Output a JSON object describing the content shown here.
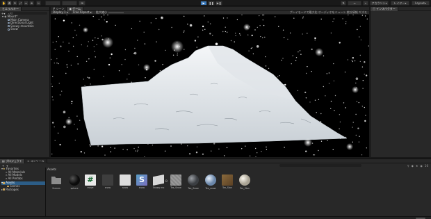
{
  "toolbar": {
    "play": "▶",
    "pause": "❚❚",
    "step": "▶❚",
    "account": "アカウント",
    "layers": "レイヤー",
    "layout": "Layout",
    "cloud": "☁"
  },
  "hierarchy": {
    "tab": "ヒエラルキー",
    "search_placeholder": "All",
    "scene": "Mount*",
    "items": [
      "Main Camera",
      "Directional Light",
      "Snowy mountain",
      "Snow"
    ]
  },
  "scene_view": {
    "tabs": [
      "シーン",
      "ゲーム"
    ],
    "display": "Display 1",
    "aspect": "Free Aspect",
    "scale": "拡大縮小",
    "right_options": "プレイモードで最大化  オーディオをミュート  統計情報  ギズモ"
  },
  "inspector": {
    "tab": "インスペクター"
  },
  "project": {
    "tabs": [
      "プロジェクト",
      "コンソール"
    ],
    "add": "+",
    "favorites": "Favorites",
    "favorite_items": [
      "All Materials",
      "All Models",
      "All Prefabs"
    ],
    "assets": "Assets",
    "asset_children": [
      "Scenes"
    ],
    "packages": "Packages",
    "breadcrumb": "Assets",
    "count": "16",
    "assets_grid": [
      {
        "name": "Scenes",
        "kind": "folder"
      },
      {
        "name": "sphere",
        "kind": "sphere-dark"
      },
      {
        "name": "move",
        "kind": "script"
      },
      {
        "name": "snow",
        "kind": "dark"
      },
      {
        "name": "snow",
        "kind": "white"
      },
      {
        "name": "snow",
        "kind": "shader"
      },
      {
        "name": "Snowy mo",
        "kind": "model"
      },
      {
        "name": "Tex_Snow",
        "kind": "gray"
      },
      {
        "name": "Tex_Snow",
        "kind": "bumpy"
      },
      {
        "name": "Tex_snow",
        "kind": "sphere-blue"
      },
      {
        "name": "Tex_Ston",
        "kind": "brown"
      },
      {
        "name": "Tex_Ston",
        "kind": "sphere-white"
      }
    ]
  }
}
